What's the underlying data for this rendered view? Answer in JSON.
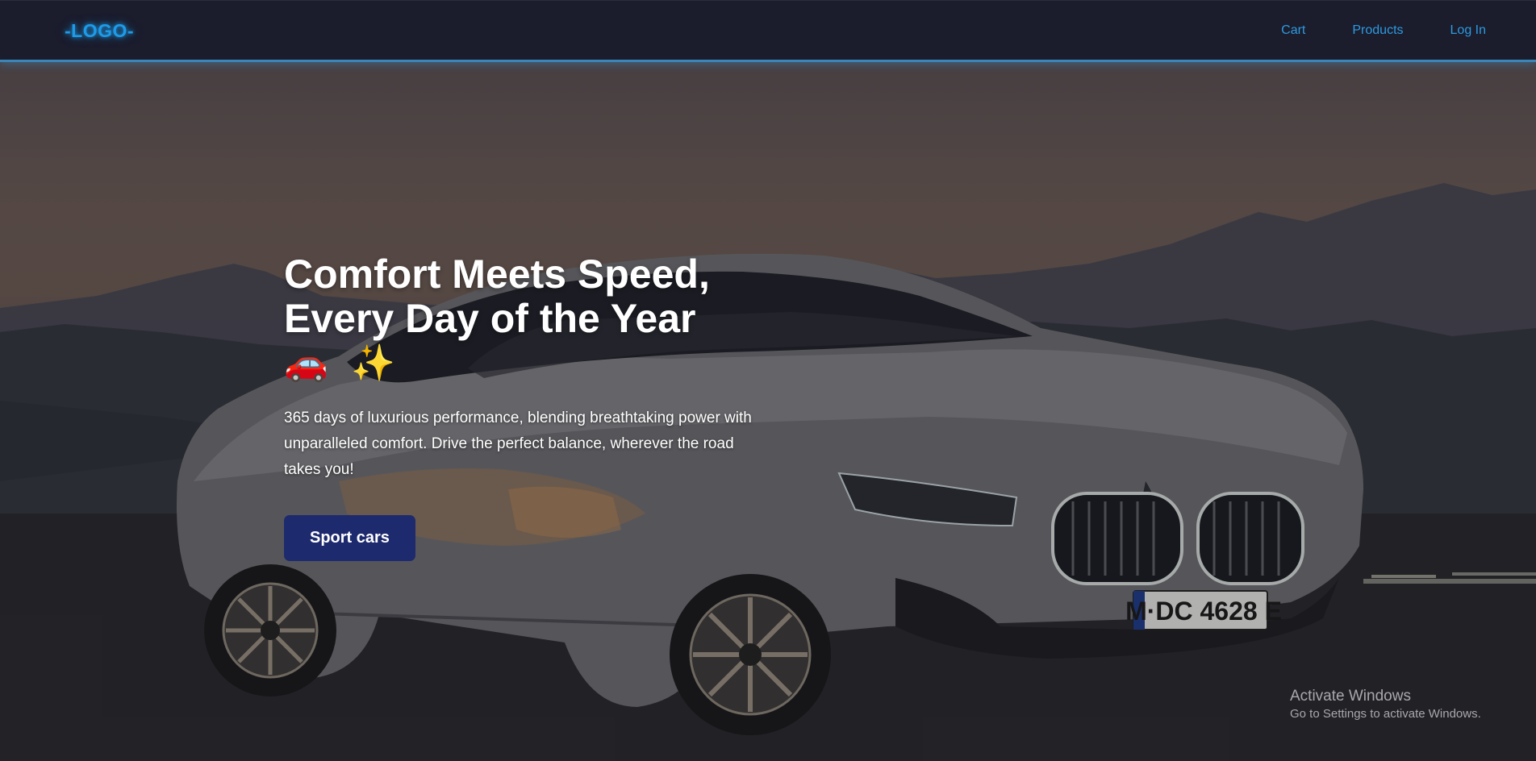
{
  "nav": {
    "logo": "-LOGO-",
    "links": [
      "Cart",
      "Products",
      "Log In"
    ]
  },
  "hero": {
    "title": "Comfort Meets Speed, Every Day of the Year",
    "emoji": "🚗 ✨",
    "text": "365 days of luxurious performance, blending breathtaking power with unparalleled comfort. Drive the perfect balance, wherever the road takes you!",
    "cta": "Sport cars",
    "license_plate": "M·DC 4628 E"
  },
  "watermark": {
    "title": "Activate Windows",
    "subtitle": "Go to Settings to activate Windows."
  },
  "colors": {
    "accent": "#1e9be8",
    "nav_bg": "#1b1c2c",
    "cta_bg": "#1e2a6e"
  }
}
